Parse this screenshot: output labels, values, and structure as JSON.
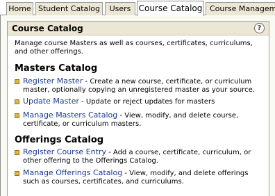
{
  "tabs": [
    {
      "label": "Home",
      "active": false
    },
    {
      "label": "Student Catalog",
      "active": false
    },
    {
      "label": "Users",
      "active": false
    },
    {
      "label": "Course Catalog",
      "active": true
    },
    {
      "label": "Course Management",
      "active": false
    }
  ],
  "panel": {
    "title": "Course Catalog",
    "help_icon": "help-icon",
    "intro": "Manage course Masters as well as courses, certificates, curriculums, and other offerings."
  },
  "masters": {
    "title": "Masters Catalog",
    "items": [
      {
        "link": "Register Master",
        "desc": " - Create a new course, certificate, or curriculum master, optionally copying an unregistered master as your source."
      },
      {
        "link": "Update Master",
        "desc": " - Update or reject updates for masters"
      },
      {
        "link": "Manage Masters Catalog",
        "desc": " - View, modify, and delete course, certificate, or curriculum masters."
      }
    ]
  },
  "offerings": {
    "title": "Offerings Catalog",
    "items": [
      {
        "link": "Register Course Entry",
        "desc": " - Add a course, certificate, curriculum, or other offering to the Offerings Catalog."
      },
      {
        "link": "Manage Offerings Catalog",
        "desc": " - View, modify, and delete offerings such as courses, certificates, and curriculums."
      }
    ]
  },
  "colors": {
    "link": "#1a3a8f",
    "tab_background": "#ece7d4",
    "bullet": "#e2b33c"
  }
}
